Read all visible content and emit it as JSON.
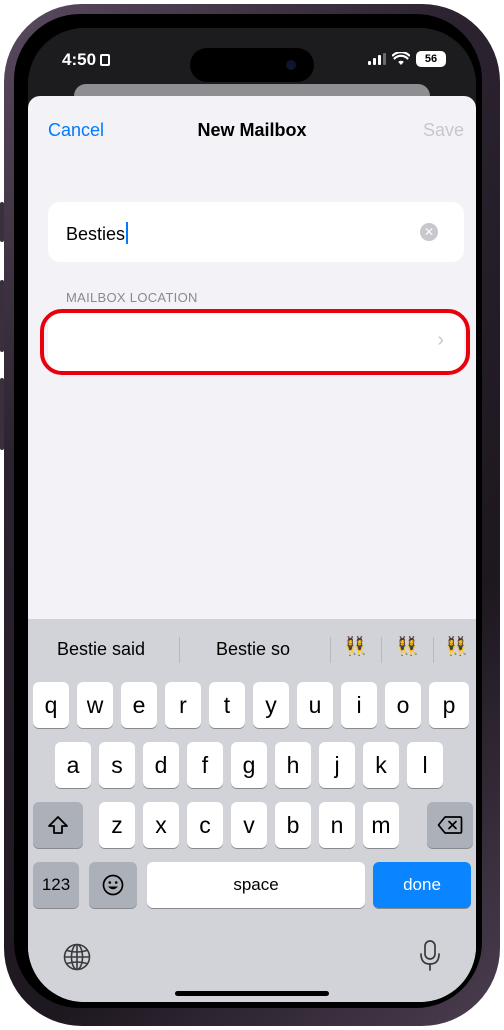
{
  "status_bar": {
    "time": "4:50",
    "battery": "56"
  },
  "nav": {
    "cancel": "Cancel",
    "title": "New Mailbox",
    "save": "Save"
  },
  "name_field": {
    "value": "Besties"
  },
  "location": {
    "header": "MAILBOX LOCATION",
    "value": ""
  },
  "keyboard": {
    "suggestions": [
      "Bestie said",
      "Bestie so"
    ],
    "emoji_suggestions": [
      "👯‍♀️",
      "👯‍♀️",
      "👯‍♀️"
    ],
    "rows": [
      [
        "q",
        "w",
        "e",
        "r",
        "t",
        "y",
        "u",
        "i",
        "o",
        "p"
      ],
      [
        "a",
        "s",
        "d",
        "f",
        "g",
        "h",
        "j",
        "k",
        "l"
      ],
      [
        "z",
        "x",
        "c",
        "v",
        "b",
        "n",
        "m"
      ]
    ],
    "numbers_label": "123",
    "space_label": "space",
    "done_label": "done"
  },
  "colors": {
    "accent": "#007aff",
    "done": "#0a84ff",
    "highlight": "#e8000b"
  }
}
